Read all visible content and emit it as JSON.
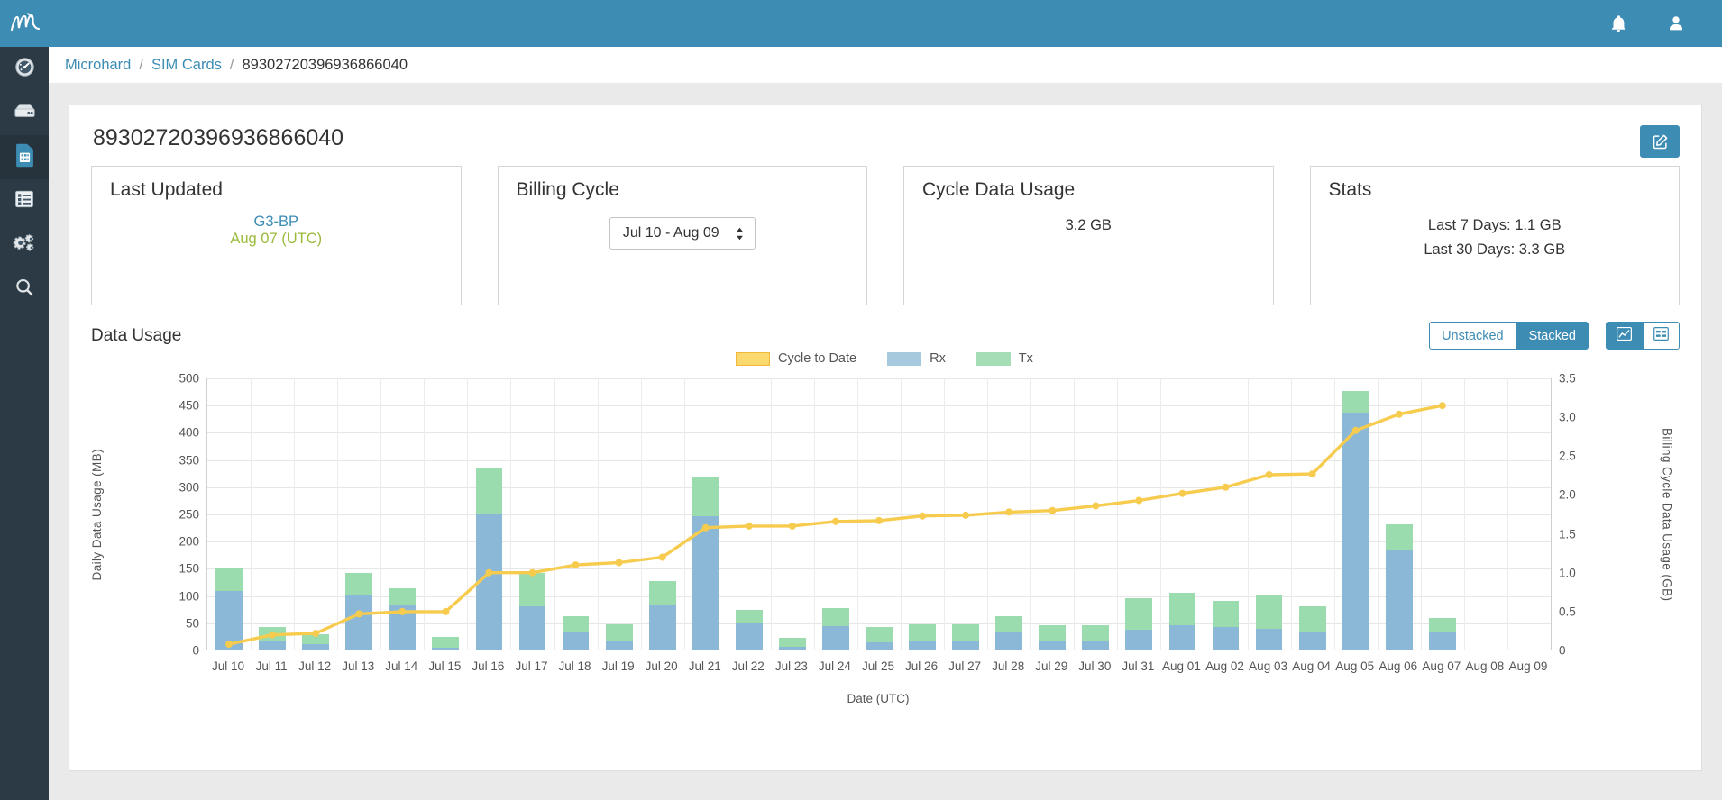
{
  "app": {
    "logo_icon": "microhard-script-logo",
    "header_icons": [
      {
        "name": "notifications-bell-icon",
        "label": "Notifications"
      },
      {
        "name": "user-account-icon",
        "label": "Account"
      }
    ],
    "accent_blue": "#3d8cb4",
    "sidebar_bg": "#2b3a44"
  },
  "sidebar": {
    "items": [
      {
        "icon": "dashboard-gauge-icon",
        "label": "Dashboard",
        "active": false
      },
      {
        "icon": "device-server-icon",
        "label": "Devices",
        "active": false
      },
      {
        "icon": "sim-card-icon",
        "label": "SIM Cards",
        "active": true
      },
      {
        "icon": "list-report-icon",
        "label": "Reports",
        "active": false
      },
      {
        "icon": "gears-settings-icon",
        "label": "Settings",
        "active": false
      },
      {
        "icon": "search-magnifier-icon",
        "label": "Search",
        "active": false
      }
    ]
  },
  "breadcrumb": {
    "items": [
      {
        "label": "Microhard",
        "link": true
      },
      {
        "label": "SIM Cards",
        "link": true
      },
      {
        "label": "89302720396936866040",
        "link": false
      }
    ],
    "separator": "/"
  },
  "page": {
    "title": "89302720396936866040",
    "edit_button": {
      "name": "edit-button",
      "icon": "pencil-square-icon"
    }
  },
  "cards": {
    "last_updated": {
      "title": "Last Updated",
      "device": "G3-BP",
      "timestamp": "Aug 07 (UTC)"
    },
    "billing_cycle": {
      "title": "Billing Cycle",
      "selected": "Jul 10 - Aug 09",
      "options": [
        "Jul 10 - Aug 09"
      ]
    },
    "cycle_data_usage": {
      "title": "Cycle Data Usage",
      "value": "3.2 GB"
    },
    "stats": {
      "title": "Stats",
      "lines": [
        "Last 7 Days: 1.1 GB",
        "Last 30 Days: 3.3 GB"
      ]
    }
  },
  "data_usage_section": {
    "title": "Data Usage",
    "stack_toggle": {
      "options": [
        {
          "label": "Unstacked",
          "active": false
        },
        {
          "label": "Stacked",
          "active": true
        }
      ]
    },
    "view_toggle": {
      "options": [
        {
          "icon": "chart-line-icon",
          "label": "Chart view",
          "active": true
        },
        {
          "icon": "table-grid-icon",
          "label": "Table view",
          "active": false
        }
      ]
    }
  },
  "chart_data": {
    "type": "bar",
    "title": "",
    "xlabel": "Date (UTC)",
    "ylabel": "Daily Data Usage (MB)",
    "y2label": "Billing Cycle Data Usage (GB)",
    "ylim": [
      0,
      500
    ],
    "y2lim": [
      0,
      3.5
    ],
    "yticks": [
      0,
      50,
      100,
      150,
      200,
      250,
      300,
      350,
      400,
      450,
      500
    ],
    "y2ticks": [
      0,
      0.5,
      1.0,
      1.5,
      2.0,
      2.5,
      3.0,
      3.5
    ],
    "grid": true,
    "legend_position": "top-center",
    "stacked": true,
    "categories": [
      "Jul 10",
      "Jul 11",
      "Jul 12",
      "Jul 13",
      "Jul 14",
      "Jul 15",
      "Jul 16",
      "Jul 17",
      "Jul 18",
      "Jul 19",
      "Jul 20",
      "Jul 21",
      "Jul 22",
      "Jul 23",
      "Jul 24",
      "Jul 25",
      "Jul 26",
      "Jul 27",
      "Jul 28",
      "Jul 29",
      "Jul 30",
      "Jul 31",
      "Aug 01",
      "Aug 02",
      "Aug 03",
      "Aug 04",
      "Aug 05",
      "Aug 06",
      "Aug 07",
      "Aug 08",
      "Aug 09"
    ],
    "series": [
      {
        "name": "Rx",
        "color": "#8cb8d8",
        "unit": "MB",
        "values": [
          108,
          15,
          10,
          100,
          82,
          3,
          250,
          80,
          32,
          16,
          82,
          245,
          50,
          5,
          43,
          14,
          17,
          17,
          33,
          16,
          16,
          37,
          44,
          42,
          38,
          32,
          435,
          182,
          32,
          0,
          0
        ]
      },
      {
        "name": "Tx",
        "color": "#9bdcae",
        "unit": "MB",
        "values": [
          42,
          26,
          18,
          40,
          31,
          20,
          85,
          60,
          30,
          31,
          44,
          73,
          23,
          16,
          34,
          27,
          30,
          30,
          29,
          29,
          29,
          57,
          61,
          47,
          62,
          48,
          40,
          48,
          26,
          0,
          0
        ]
      }
    ],
    "cumulative_line": {
      "name": "Cycle to Date",
      "color": "#f6cb4e",
      "unit": "GB",
      "values": [
        0.08,
        0.2,
        0.22,
        0.47,
        0.5,
        0.5,
        1.0,
        1.0,
        1.1,
        1.13,
        1.2,
        1.58,
        1.6,
        1.6,
        1.66,
        1.67,
        1.73,
        1.74,
        1.78,
        1.8,
        1.86,
        1.93,
        2.02,
        2.1,
        2.26,
        2.27,
        2.83,
        3.04,
        3.15,
        null,
        null
      ]
    }
  }
}
